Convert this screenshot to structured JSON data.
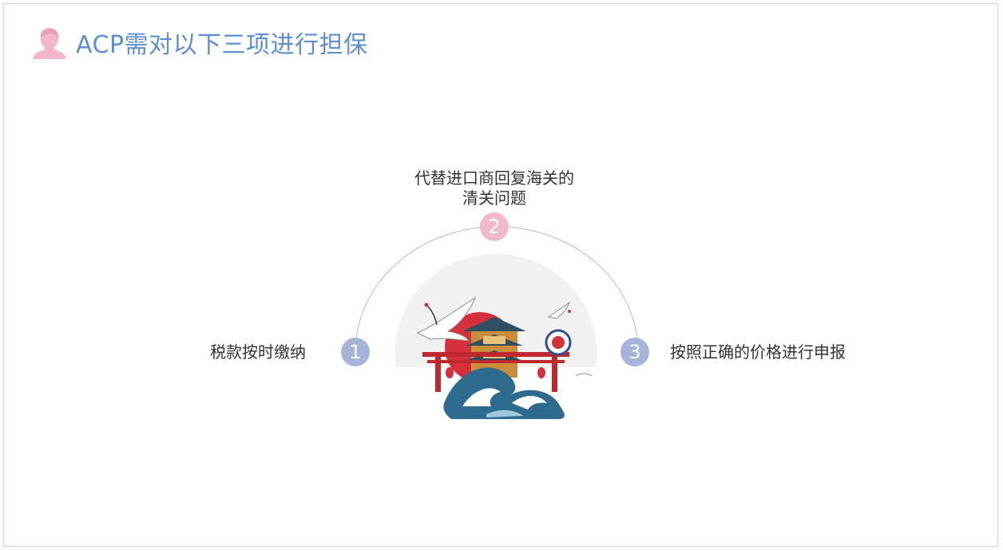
{
  "title": "ACP需对以下三项进行担保",
  "colors": {
    "title": "#5b8fd1",
    "accent_pink": "#f2b8cb",
    "accent_blue": "#a5b4d8",
    "border": "#f2c7d5"
  },
  "icons": {
    "title_icon": "person-silhouette-icon",
    "illustration": "japanese-pagoda-wave-illustration"
  },
  "items": [
    {
      "number": "1",
      "text": "税款按时缴纳"
    },
    {
      "number": "2",
      "line1": "代替进口商回复海关的",
      "line2": "清关问题"
    },
    {
      "number": "3",
      "text": "按照正确的价格进行申报"
    }
  ]
}
